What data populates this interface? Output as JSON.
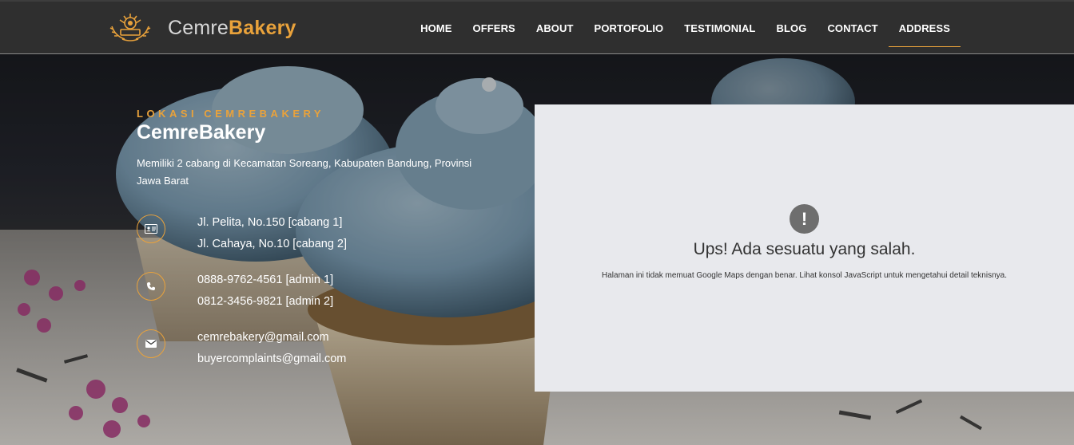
{
  "brand": {
    "name_light": "Cemre",
    "name_bold": "Bakery",
    "logo": "bakery-crest-logo"
  },
  "nav": {
    "items": [
      "HOME",
      "OFFERS",
      "ABOUT",
      "PORTOFOLIO",
      "TESTIMONIAL",
      "BLOG",
      "CONTACT",
      "ADDRESS"
    ],
    "active": "ADDRESS"
  },
  "colors": {
    "accent": "#e9a23b",
    "navbar": "#2f2f2f",
    "map_bg": "#e8e9ed",
    "frosting": "#7fa1b8"
  },
  "section": {
    "eyebrow": "LOKASI CEMREBAKERY",
    "title": "CemreBakery",
    "description": "Memiliki 2 cabang di Kecamatan Soreang, Kabupaten Bandung, Provinsi Jawa Barat"
  },
  "contacts": {
    "address": {
      "icon": "address-card-icon",
      "lines": [
        "Jl. Pelita, No.150 [cabang 1]",
        "Jl. Cahaya, No.10 [cabang 2]"
      ]
    },
    "phone": {
      "icon": "phone-icon",
      "lines": [
        "0888-9762-4561 [admin 1]",
        "0812-3456-9821 [admin 2]"
      ]
    },
    "email": {
      "icon": "envelope-icon",
      "lines": [
        "cemrebakery@gmail.com",
        "buyercomplaints@gmail.com"
      ]
    }
  },
  "map_error": {
    "icon": "exclamation-icon",
    "symbol": "!",
    "title": "Ups! Ada sesuatu yang salah.",
    "message": "Halaman ini tidak memuat Google Maps dengan benar. Lihat konsol JavaScript untuk mengetahui detail teknisnya."
  }
}
